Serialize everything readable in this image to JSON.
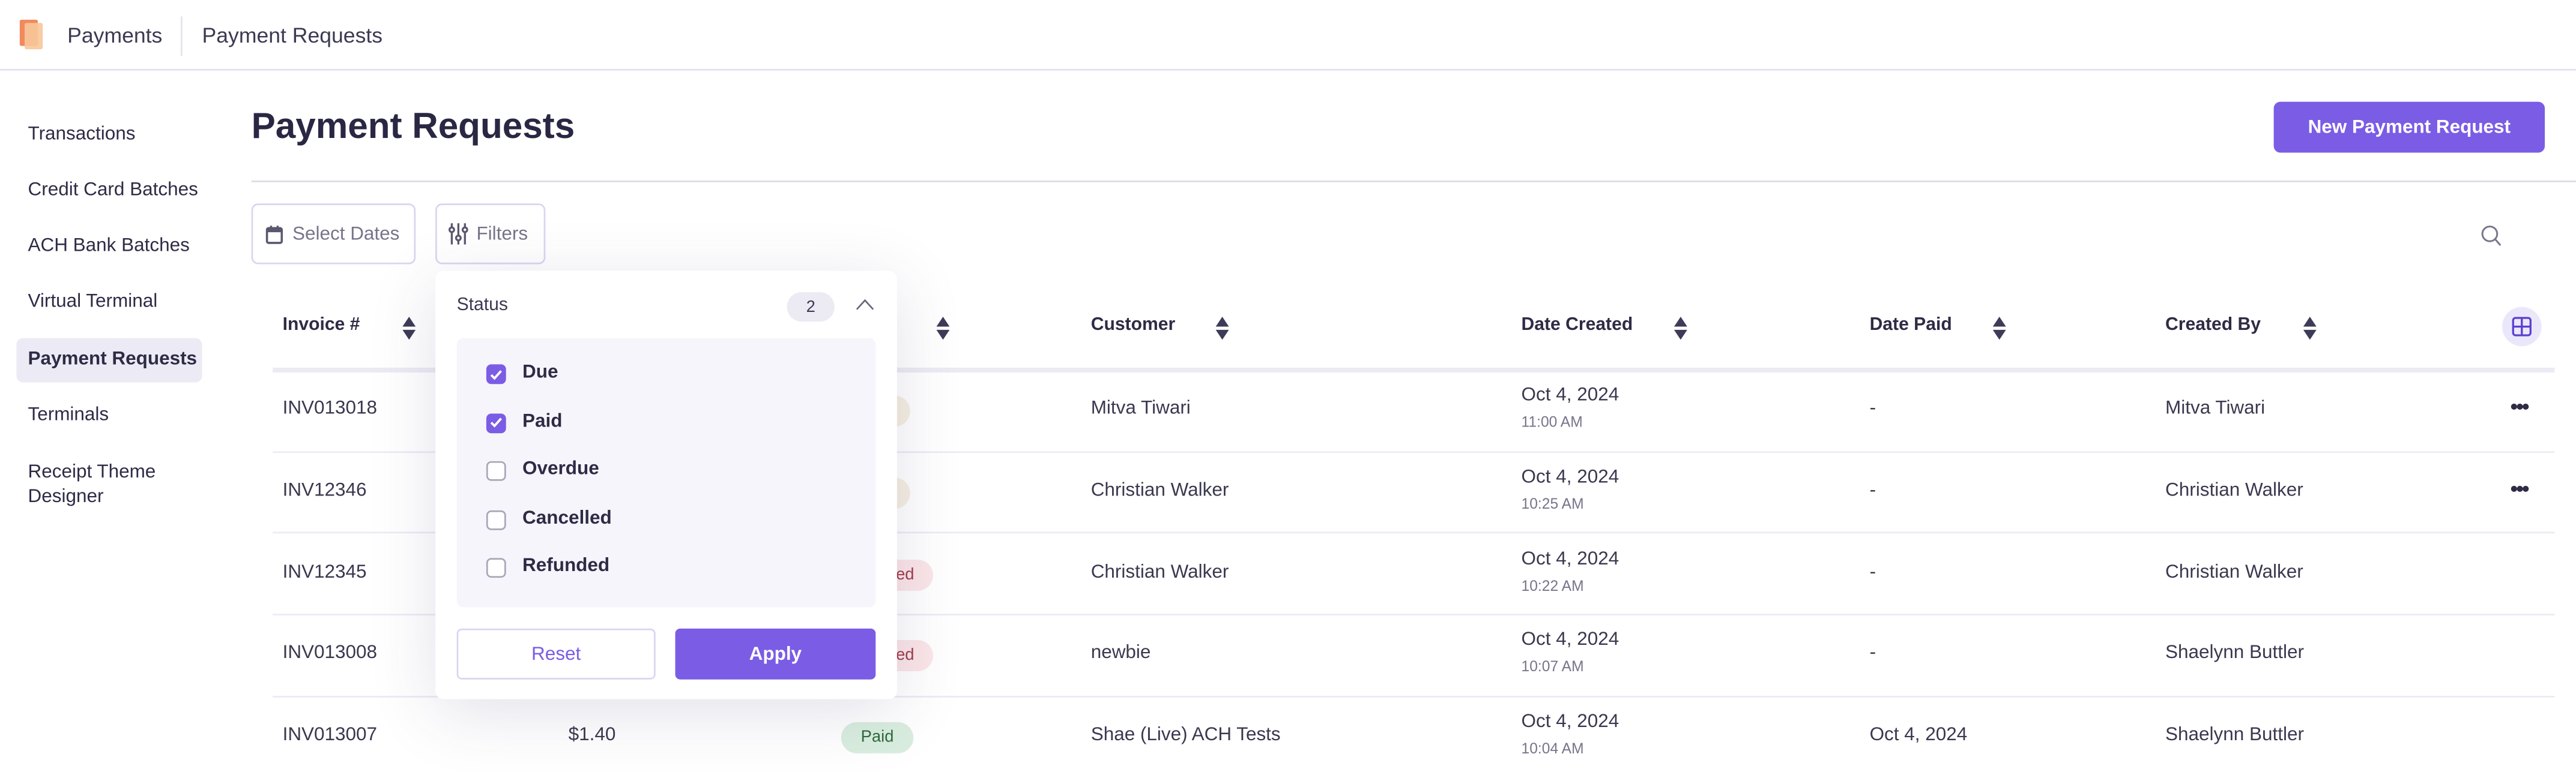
{
  "app": {
    "name": "Payments",
    "breadcrumb": "Payment Requests"
  },
  "sidebar": {
    "items": [
      {
        "label": "Transactions"
      },
      {
        "label": "Credit Card Batches"
      },
      {
        "label": "ACH Bank Batches"
      },
      {
        "label": "Virtual Terminal"
      },
      {
        "label": "Payment Requests",
        "active": true
      },
      {
        "label": "Terminals"
      },
      {
        "label": "Receipt Theme Designer"
      }
    ]
  },
  "page": {
    "title": "Payment Requests",
    "new_button": "New Payment Request"
  },
  "toolbar": {
    "dates_label": "Select Dates",
    "filters_label": "Filters"
  },
  "table": {
    "columns": [
      "Invoice #",
      "Customer",
      "Date Created",
      "Date Paid",
      "Created By"
    ],
    "rows": [
      {
        "invoice": "INV013018",
        "amount": "",
        "status": "",
        "customer": "Mitva Tiwari",
        "date": "Oct 4, 2024",
        "time": "11:00 AM",
        "paid": "-",
        "created_by": "Mitva Tiwari",
        "menu": true
      },
      {
        "invoice": "INV12346",
        "amount": "",
        "status": "",
        "customer": "Christian Walker",
        "date": "Oct 4, 2024",
        "time": "10:25 AM",
        "paid": "-",
        "created_by": "Christian Walker",
        "menu": true
      },
      {
        "invoice": "INV12345",
        "amount": "",
        "status": "Cancelled",
        "customer": "Christian Walker",
        "date": "Oct 4, 2024",
        "time": "10:22 AM",
        "paid": "-",
        "created_by": "Christian Walker"
      },
      {
        "invoice": "INV013008",
        "amount": "",
        "status": "Cancelled",
        "customer": "newbie",
        "date": "Oct 4, 2024",
        "time": "10:07 AM",
        "paid": "-",
        "created_by": "Shaelynn Buttler"
      },
      {
        "invoice": "INV013007",
        "amount": "$1.40",
        "status": "Paid",
        "customer": "Shae (Live) ACH Tests",
        "date": "Oct 4, 2024",
        "time": "10:04 AM",
        "paid": "Oct 4, 2024",
        "created_by": "Shaelynn Buttler"
      }
    ]
  },
  "filter_popup": {
    "section": "Status",
    "count": "2",
    "options": [
      {
        "label": "Due",
        "checked": true
      },
      {
        "label": "Paid",
        "checked": true
      },
      {
        "label": "Overdue",
        "checked": false
      },
      {
        "label": "Cancelled",
        "checked": false
      },
      {
        "label": "Refunded",
        "checked": false
      }
    ],
    "reset": "Reset",
    "apply": "Apply"
  },
  "colors": {
    "accent": "#7b5ce5",
    "due_badge": "#f6efe1",
    "cancelled_badge": "#fbe6e8",
    "paid_badge": "#d9eedf"
  }
}
